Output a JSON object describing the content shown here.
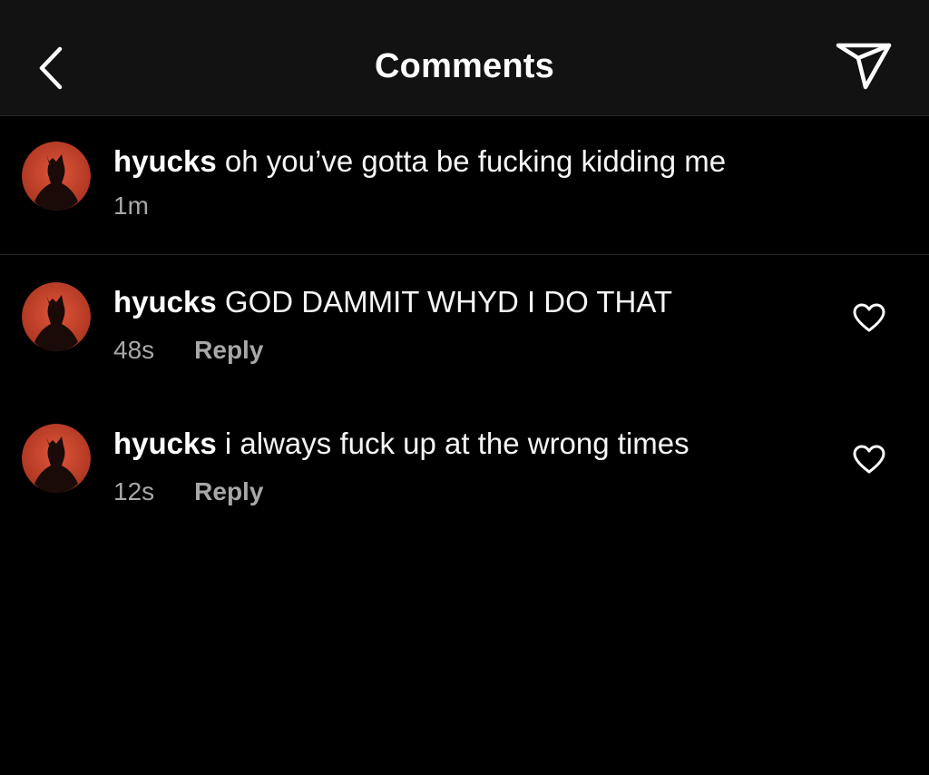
{
  "header": {
    "title": "Comments",
    "back_icon": "chevron-left-icon",
    "share_icon": "paper-plane-icon"
  },
  "caption": {
    "username": "hyucks",
    "text": "oh you’ve gotta be fucking kidding me",
    "time": "1m"
  },
  "comments": [
    {
      "username": "hyucks",
      "text": "GOD DAMMIT WHYD I DO THAT",
      "time": "48s",
      "reply_label": "Reply",
      "like_icon": "heart-outline-icon"
    },
    {
      "username": "hyucks",
      "text": "i always fuck up at the wrong times",
      "time": "12s",
      "reply_label": "Reply",
      "like_icon": "heart-outline-icon"
    }
  ],
  "colors": {
    "background": "#000000",
    "header_bg": "#121212",
    "text": "#f5f5f5",
    "secondary_text": "#a8a8a8",
    "avatar_red": "#c9432b"
  }
}
